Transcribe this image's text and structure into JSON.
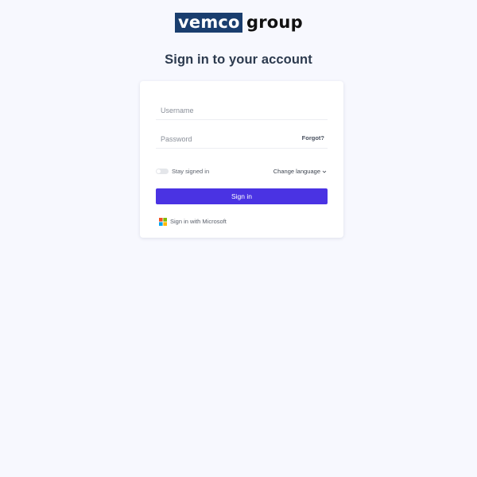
{
  "logo": {
    "boxed_text": "vemco",
    "word_text": "group"
  },
  "page_title": "Sign in to your account",
  "form": {
    "username_placeholder": "Username",
    "username_value": "",
    "password_placeholder": "Password",
    "password_value": "",
    "forgot_label": "Forgot?",
    "stay_signed_in_label": "Stay signed in",
    "stay_signed_in_checked": false,
    "change_language_label": "Change language",
    "signin_label": "Sign in",
    "microsoft_label": "Sign in with Microsoft"
  },
  "colors": {
    "background": "#f7f8fe",
    "logo_box": "#1a3e6e",
    "primary_button": "#4a33e3",
    "title": "#2c3a4e"
  },
  "icons": {
    "language_chevron": "chevron-down-icon",
    "microsoft": "microsoft-logo-icon"
  }
}
